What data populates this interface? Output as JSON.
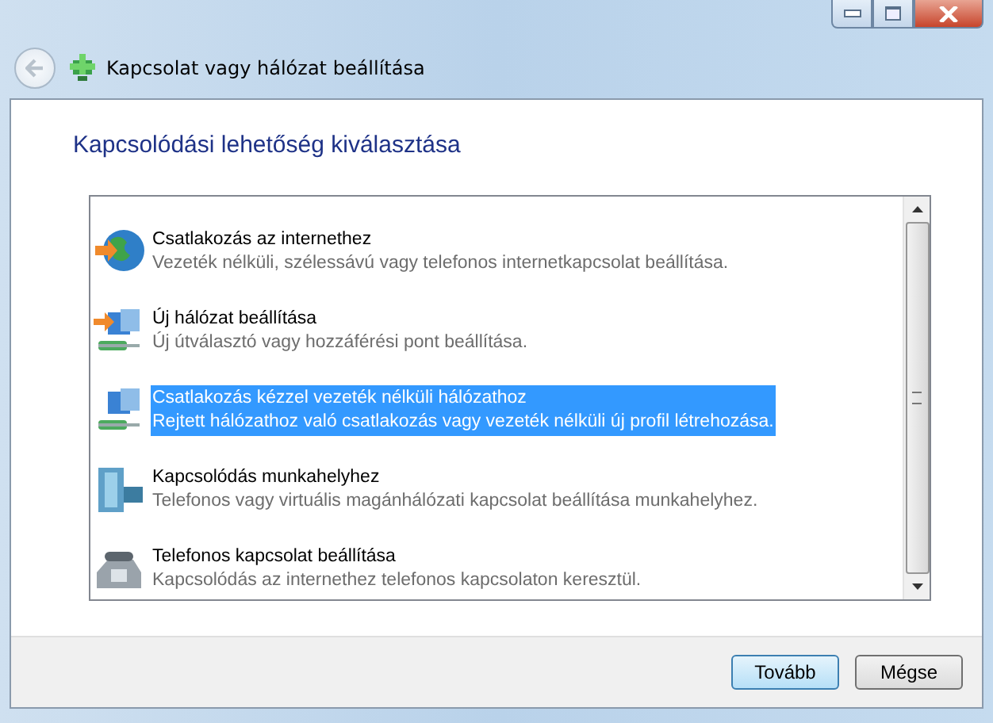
{
  "window": {
    "title": "Kapcsolat vagy hálózat beállítása"
  },
  "heading": "Kapcsolódási lehetőség kiválasztása",
  "options": [
    {
      "kind": "globe",
      "title": "Csatlakozás az internethez",
      "description": "Vezeték nélküli, szélessávú vagy telefonos internetkapcsolat beállítása.",
      "selected": false
    },
    {
      "kind": "router",
      "title": "Új hálózat beállítása",
      "description": "Új útválasztó vagy hozzáférési pont beállítása.",
      "selected": false
    },
    {
      "kind": "wireless",
      "title": "Csatlakozás kézzel vezeték nélküli hálózathoz",
      "description": "Rejtett hálózathoz való csatlakozás vagy vezeték nélküli új profil létrehozása.",
      "selected": true
    },
    {
      "kind": "workplace",
      "title": "Kapcsolódás munkahelyhez",
      "description": "Telefonos vagy virtuális magánhálózati kapcsolat beállítása munkahelyhez.",
      "selected": false
    },
    {
      "kind": "phone",
      "title": "Telefonos kapcsolat beállítása",
      "description": "Kapcsolódás az internethez telefonos kapcsolaton keresztül.",
      "selected": false
    }
  ],
  "buttons": [
    {
      "label": "Tovább",
      "default": true
    },
    {
      "label": "Mégse",
      "default": false
    }
  ]
}
